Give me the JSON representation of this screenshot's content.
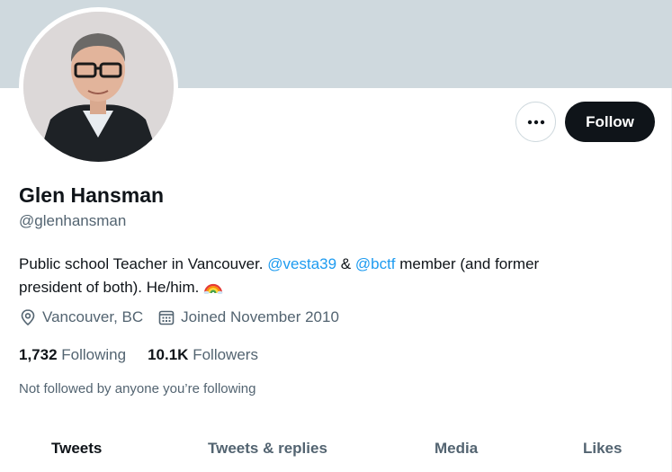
{
  "profile": {
    "name": "Glen Hansman",
    "handle": "@glenhansman",
    "bio": {
      "line1_text": "Public school Teacher in Vancouver. ",
      "mention1": "@vesta39",
      "amp": " & ",
      "mention2": "@bctf",
      "line1_tail": " member (and former",
      "line2_text": "president of both).  He/him. "
    },
    "location": "Vancouver, BC",
    "joined": "Joined November 2010",
    "following_count": "1,732",
    "following_label": "Following",
    "followers_count": "10.1K",
    "followers_label": "Followers",
    "not_followed": "Not followed by anyone you’re following"
  },
  "actions": {
    "follow_label": "Follow"
  },
  "tabs": [
    {
      "label": "Tweets",
      "active": true
    },
    {
      "label": "Tweets & replies",
      "active": false
    },
    {
      "label": "Media",
      "active": false
    },
    {
      "label": "Likes",
      "active": false
    }
  ],
  "colors": {
    "accent": "#1d9bf0",
    "banner": "#cfd9de",
    "text_primary": "#0f1419",
    "text_secondary": "#536471"
  },
  "icons": {
    "more": "more-dots-icon",
    "location": "location-pin-icon",
    "calendar": "calendar-icon",
    "rainbow": "rainbow-emoji-icon"
  }
}
